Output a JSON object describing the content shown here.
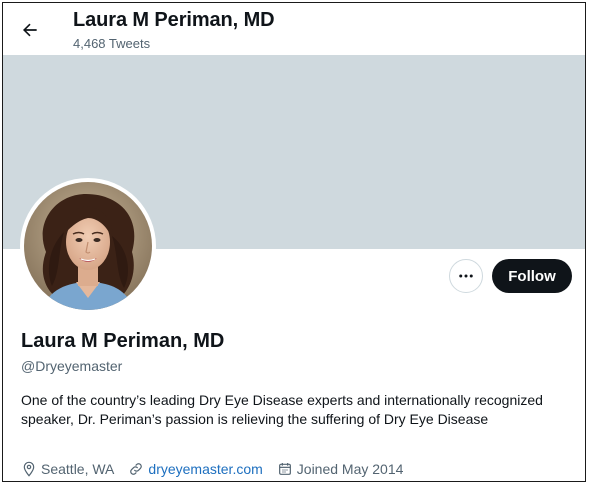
{
  "header": {
    "title": "Laura M Periman, MD",
    "tweet_count": "4,468 Tweets",
    "back_icon": "arrow-left-icon"
  },
  "banner": {
    "color": "#cfd9de"
  },
  "actions": {
    "more_icon": "more-horizontal-icon",
    "follow_label": "Follow"
  },
  "profile": {
    "name": "Laura M Periman, MD",
    "handle": "@Dryeyemaster",
    "bio": "One of the country’s leading Dry Eye Disease experts and internationally recognized speaker, Dr. Periman’s passion is relieving the suffering of Dry Eye Disease",
    "location": "Seattle, WA",
    "website": "dryeyemaster.com",
    "joined": "Joined May 2014"
  },
  "colors": {
    "text_primary": "#0f1419",
    "text_secondary": "#536471",
    "link": "#1d6fbf",
    "follow_bg": "#0f1419"
  }
}
